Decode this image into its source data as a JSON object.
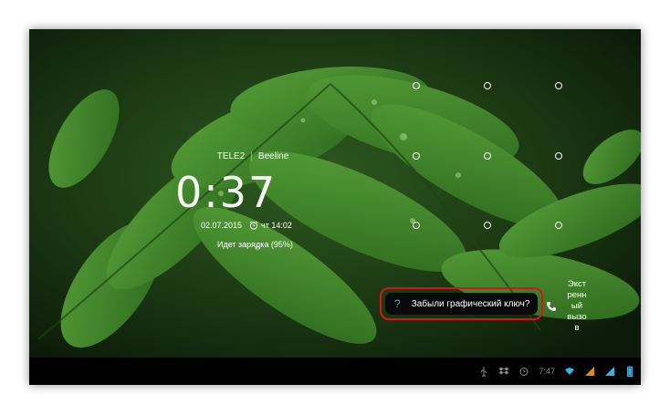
{
  "lockscreen": {
    "carrier_primary": "TELE2",
    "carrier_separator": "|",
    "carrier_secondary": "Beeline",
    "clock": "0:37",
    "date": "02.07.2015",
    "alarm": "чт 14:02",
    "charging": "Идет зарядка (95%)",
    "forgot_pattern": "Забыли графический ключ?",
    "forgot_icon": "?",
    "emergency_call_lines": [
      "Экст",
      "ренн",
      "ый",
      "вызо",
      "в"
    ]
  },
  "statusbar": {
    "time": "7:47",
    "icons": [
      "usb-icon",
      "dropbox-icon",
      "alarm-icon",
      "wifi-icon",
      "signal-icon",
      "signal-icon",
      "battery-icon"
    ]
  },
  "colors": {
    "highlight": "#d8141a",
    "accent": "#3fb1e0",
    "wallpaper_green": "#3c8a2a"
  }
}
